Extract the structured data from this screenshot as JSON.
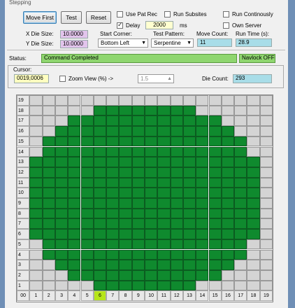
{
  "group_title": "Stepping",
  "buttons": {
    "move_first": "Move First",
    "test": "Test",
    "reset": "Reset"
  },
  "options": {
    "use_pat_rec": {
      "label": "Use Pat Rec",
      "checked": false
    },
    "run_subsites": {
      "label": "Run Subsites",
      "checked": false
    },
    "run_continously": {
      "label": "Run Continously",
      "checked": false
    },
    "delay": {
      "label": "Delay",
      "checked": true,
      "value": "2000",
      "unit": "ms"
    },
    "own_server": {
      "label": "Own Server",
      "checked": false
    }
  },
  "die": {
    "x_label": "X Die Size:",
    "x_value": "10.0000",
    "y_label": "Y Die Size:",
    "y_value": "10.0000"
  },
  "start_corner": {
    "label": "Start Corner:",
    "value": "Bottom Left"
  },
  "test_pattern": {
    "label": "Test Pattern:",
    "value": "Serpentine"
  },
  "move_count": {
    "label": "Move Count:",
    "value": "11"
  },
  "run_time": {
    "label": "Run Time (s):",
    "value": "28.9"
  },
  "status": {
    "label": "Status:",
    "value": "Command Completed",
    "navlock": "Navlock OFF"
  },
  "cursor": {
    "label": "Cursor:",
    "value": "0019,0006"
  },
  "zoom": {
    "label": "Zoom View (%) ->",
    "checked": false,
    "value": "1.5"
  },
  "die_count": {
    "label": "Die Count:",
    "value": "293"
  },
  "map": {
    "rows": [
      {
        "y": "19",
        "on": []
      },
      {
        "y": "18",
        "on": [
          6,
          7,
          8,
          9,
          10,
          11,
          12,
          13
        ]
      },
      {
        "y": "17",
        "on": [
          4,
          5,
          6,
          7,
          8,
          9,
          10,
          11,
          12,
          13,
          14,
          15
        ]
      },
      {
        "y": "16",
        "on": [
          3,
          4,
          5,
          6,
          7,
          8,
          9,
          10,
          11,
          12,
          13,
          14,
          15,
          16
        ]
      },
      {
        "y": "15",
        "on": [
          2,
          3,
          4,
          5,
          6,
          7,
          8,
          9,
          10,
          11,
          12,
          13,
          14,
          15,
          16,
          17
        ]
      },
      {
        "y": "14",
        "on": [
          2,
          3,
          4,
          5,
          6,
          7,
          8,
          9,
          10,
          11,
          12,
          13,
          14,
          15,
          16,
          17
        ]
      },
      {
        "y": "13",
        "on": [
          1,
          2,
          3,
          4,
          5,
          6,
          7,
          8,
          9,
          10,
          11,
          12,
          13,
          14,
          15,
          16,
          17,
          18
        ]
      },
      {
        "y": "12",
        "on": [
          1,
          2,
          3,
          4,
          5,
          6,
          7,
          8,
          9,
          10,
          11,
          12,
          13,
          14,
          15,
          16,
          17,
          18
        ]
      },
      {
        "y": "11",
        "on": [
          1,
          2,
          3,
          4,
          5,
          6,
          7,
          8,
          9,
          10,
          11,
          12,
          13,
          14,
          15,
          16,
          17,
          18
        ]
      },
      {
        "y": "10",
        "on": [
          1,
          2,
          3,
          4,
          5,
          6,
          7,
          8,
          9,
          10,
          11,
          12,
          13,
          14,
          15,
          16,
          17,
          18
        ]
      },
      {
        "y": "9",
        "on": [
          1,
          2,
          3,
          4,
          5,
          6,
          7,
          8,
          9,
          10,
          11,
          12,
          13,
          14,
          15,
          16,
          17,
          18
        ]
      },
      {
        "y": "8",
        "on": [
          1,
          2,
          3,
          4,
          5,
          6,
          7,
          8,
          9,
          10,
          11,
          12,
          13,
          14,
          15,
          16,
          17,
          18
        ]
      },
      {
        "y": "7",
        "on": [
          1,
          2,
          3,
          4,
          5,
          6,
          7,
          8,
          9,
          10,
          11,
          12,
          13,
          14,
          15,
          16,
          17,
          18
        ]
      },
      {
        "y": "6",
        "on": [
          1,
          2,
          3,
          4,
          5,
          6,
          7,
          8,
          9,
          10,
          11,
          12,
          13,
          14,
          15,
          16,
          17,
          18
        ]
      },
      {
        "y": "5",
        "on": [
          2,
          3,
          4,
          5,
          6,
          7,
          8,
          9,
          10,
          11,
          12,
          13,
          14,
          15,
          16,
          17
        ]
      },
      {
        "y": "4",
        "on": [
          2,
          3,
          4,
          5,
          6,
          7,
          8,
          9,
          10,
          11,
          12,
          13,
          14,
          15,
          16,
          17
        ]
      },
      {
        "y": "3",
        "on": [
          3,
          4,
          5,
          6,
          7,
          8,
          9,
          10,
          11,
          12,
          13,
          14,
          15,
          16
        ]
      },
      {
        "y": "2",
        "on": [
          4,
          5,
          6,
          7,
          8,
          9,
          10,
          11,
          12,
          13,
          14,
          15
        ]
      },
      {
        "y": "1",
        "on": [
          6,
          7,
          8,
          9,
          10,
          11,
          12,
          13
        ]
      }
    ],
    "x_labels": [
      "00",
      "1",
      "2",
      "3",
      "4",
      "5",
      "6",
      "7",
      "8",
      "9",
      "10",
      "11",
      "12",
      "13",
      "14",
      "15",
      "16",
      "17",
      "18",
      "19"
    ],
    "highlight_x": "6",
    "colors": {
      "on": "#0f8a2e",
      "off": "#d4d4d4",
      "highlight": "#b6e61a"
    }
  }
}
